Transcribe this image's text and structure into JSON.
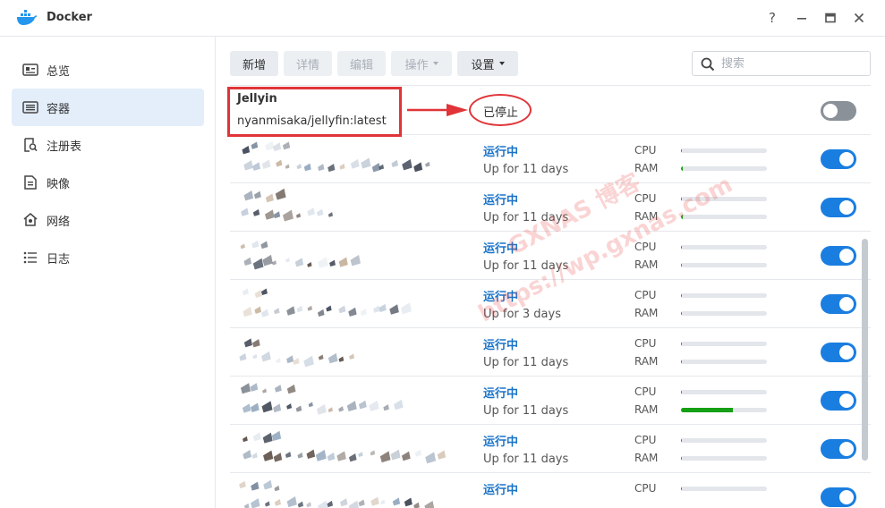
{
  "window": {
    "title": "Docker"
  },
  "sidebar": {
    "items": [
      {
        "label": "总览",
        "icon": "overview-icon"
      },
      {
        "label": "容器",
        "icon": "container-list-icon",
        "active": true
      },
      {
        "label": "注册表",
        "icon": "registry-search-icon"
      },
      {
        "label": "映像",
        "icon": "image-icon"
      },
      {
        "label": "网络",
        "icon": "network-icon"
      },
      {
        "label": "日志",
        "icon": "log-icon"
      }
    ]
  },
  "toolbar": {
    "add": "新增",
    "details": "详情",
    "edit": "编辑",
    "action": "操作",
    "settings": "设置"
  },
  "search": {
    "placeholder": "搜索"
  },
  "first_container": {
    "name": "Jellyin",
    "image": "nyanmisaka/jellyfin:latest",
    "status": "已停止",
    "enabled": false
  },
  "containers": [
    {
      "status": "运行中",
      "uptime": "Up for 11 days",
      "cpu": 0.0,
      "ram": 0.02,
      "enabled": true
    },
    {
      "status": "运行中",
      "uptime": "Up for 11 days",
      "cpu": 0.0,
      "ram": 0.02,
      "enabled": true
    },
    {
      "status": "运行中",
      "uptime": "Up for 11 days",
      "cpu": 0.01,
      "ram": 0.01,
      "enabled": true
    },
    {
      "status": "运行中",
      "uptime": "Up for 3 days",
      "cpu": 0.0,
      "ram": 0.01,
      "enabled": true
    },
    {
      "status": "运行中",
      "uptime": "Up for 11 days",
      "cpu": 0.0,
      "ram": 0.0,
      "enabled": true
    },
    {
      "status": "运行中",
      "uptime": "Up for 11 days",
      "cpu": 0.01,
      "ram": 0.6,
      "enabled": true
    },
    {
      "status": "运行中",
      "uptime": "Up for 11 days",
      "cpu": 0.01,
      "ram": 0.01,
      "enabled": true
    },
    {
      "status": "运行中",
      "uptime": "",
      "cpu": 0.0,
      "ram": null,
      "enabled": true
    }
  ],
  "labels": {
    "cpu": "CPU",
    "ram": "RAM"
  },
  "watermark": {
    "line1": "GXNAS 博客",
    "line2": "https://wp.gxnas.com"
  },
  "colors": {
    "accent": "#1a7ee0",
    "annotation": "#e03438",
    "status_running": "#1a73c8",
    "ram_fill": "#15a015"
  }
}
